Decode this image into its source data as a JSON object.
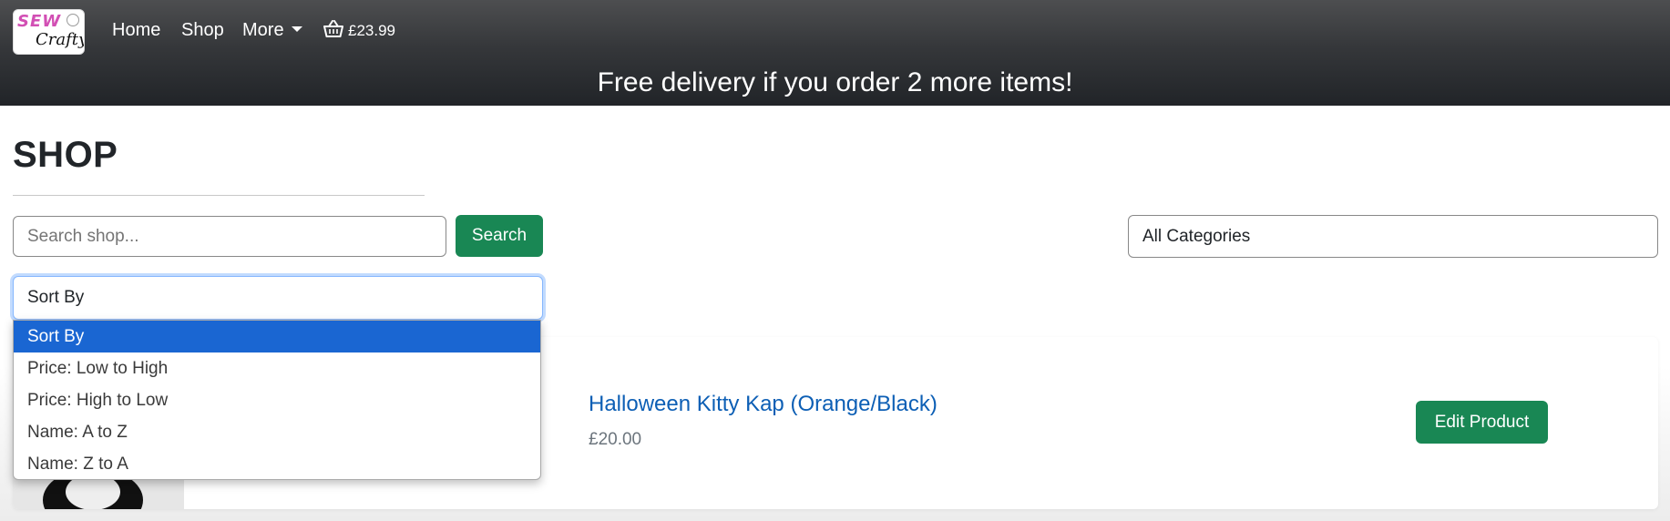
{
  "header": {
    "logo_text_top": "SEW",
    "logo_text_bottom": "Crafty",
    "nav": {
      "home": "Home",
      "shop": "Shop",
      "more": "More"
    },
    "cart_total": "£23.99",
    "promo": "Free delivery if you order 2 more items!"
  },
  "page": {
    "title": "SHOP",
    "search": {
      "placeholder": "Search shop...",
      "button": "Search"
    },
    "category_select": {
      "value": "All Categories"
    },
    "sort_select": {
      "value": "Sort By",
      "options": [
        "Sort By",
        "Price: Low to High",
        "Price: High to Low",
        "Name: A to Z",
        "Name: Z to A"
      ],
      "highlighted_index": 0
    }
  },
  "products": [
    {
      "name": "Halloween Kitty Kap (Orange/Black)",
      "price": "£20.00",
      "action": "Edit Product"
    }
  ],
  "colors": {
    "primary_green": "#198754",
    "link_blue": "#0d5fb5",
    "selected_option": "#1a66d2",
    "navbar_dark": "#212428"
  }
}
